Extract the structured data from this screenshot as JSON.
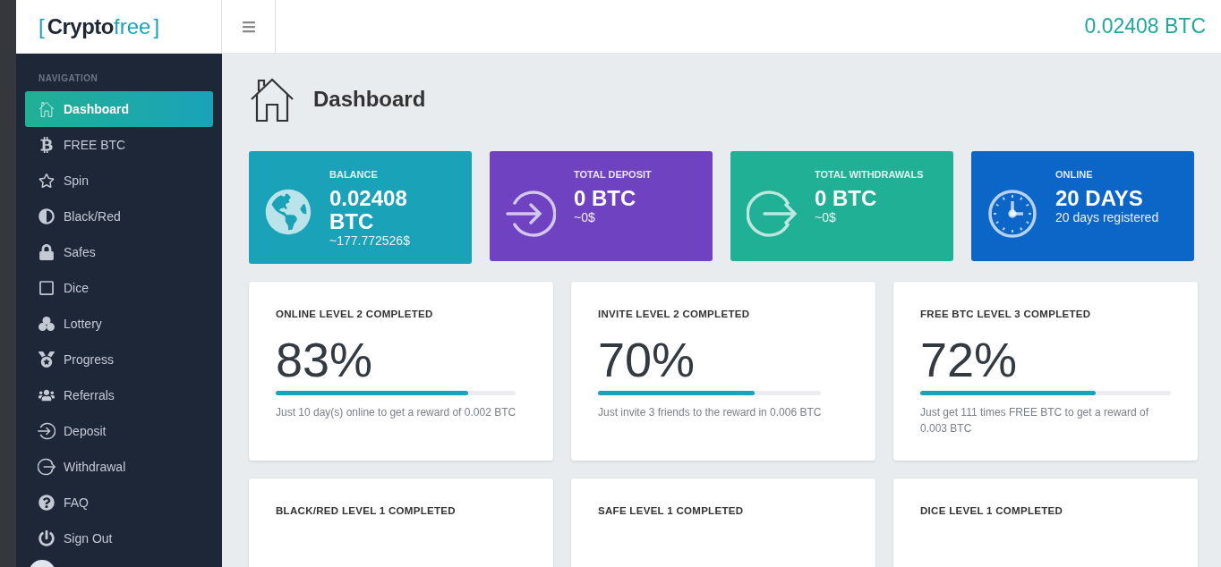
{
  "logo": {
    "open_bracket": "[",
    "dark_part": "Crypto",
    "accent_part": "free",
    "close_bracket": "]"
  },
  "header": {
    "balance": "0.02408 BTC"
  },
  "sidebar": {
    "heading": "NAVIGATION",
    "items": [
      {
        "label": "Dashboard",
        "kind": "home",
        "selected": true
      },
      {
        "label": "FREE BTC",
        "kind": "bitcoin",
        "selected": false
      },
      {
        "label": "Spin",
        "kind": "star",
        "selected": false
      },
      {
        "label": "Black/Red",
        "kind": "contrast",
        "selected": false
      },
      {
        "label": "Safes",
        "kind": "lock",
        "selected": false
      },
      {
        "label": "Dice",
        "kind": "square",
        "selected": false
      },
      {
        "label": "Lottery",
        "kind": "balls",
        "selected": false
      },
      {
        "label": "Progress",
        "kind": "medal",
        "selected": false
      },
      {
        "label": "Referrals",
        "kind": "users",
        "selected": false
      },
      {
        "label": "Deposit",
        "kind": "enter",
        "selected": false
      },
      {
        "label": "Withdrawal",
        "kind": "exit",
        "selected": false
      },
      {
        "label": "FAQ",
        "kind": "question",
        "selected": false
      },
      {
        "label": "Sign Out",
        "kind": "power",
        "selected": false
      }
    ]
  },
  "page": {
    "title": "Dashboard"
  },
  "stats": [
    {
      "kind": "globe",
      "color": "#1aa3b8",
      "label": "BALANCE",
      "value": "0.02408 BTC",
      "sub": "~177.772526$"
    },
    {
      "kind": "enter",
      "color": "#6f42c1",
      "label": "TOTAL DEPOSIT",
      "value": "0 BTC",
      "sub": "~0$"
    },
    {
      "kind": "exit",
      "color": "#20b095",
      "label": "TOTAL WITHDRAWALS",
      "value": "0 BTC",
      "sub": "~0$"
    },
    {
      "kind": "clock",
      "color": "#0b66c8",
      "label": "ONLINE",
      "value": "20 DAYS",
      "sub": "20 days registered"
    }
  ],
  "levels": [
    {
      "title": "ONLINE LEVEL 2 COMPLETED",
      "percent": "83%",
      "level": 0.8,
      "note": "Just 10 day(s) online to get a reward of 0.002 BTC"
    },
    {
      "title": "INVITE LEVEL 2 COMPLETED",
      "percent": "70%",
      "level": 0.7,
      "note": "Just invite 3 friends to the reward in 0.006 BTC"
    },
    {
      "title": "FREE BTC LEVEL 3 COMPLETED",
      "percent": "72%",
      "level": 0.7,
      "note": "Just get 111 times FREE BTC to get a reward of 0.003 BTC"
    },
    {
      "title": "BLACK/RED LEVEL 1 COMPLETED"
    },
    {
      "title": "SAFE LEVEL 1 COMPLETED"
    },
    {
      "title": "DICE LEVEL 1 COMPLETED"
    }
  ]
}
